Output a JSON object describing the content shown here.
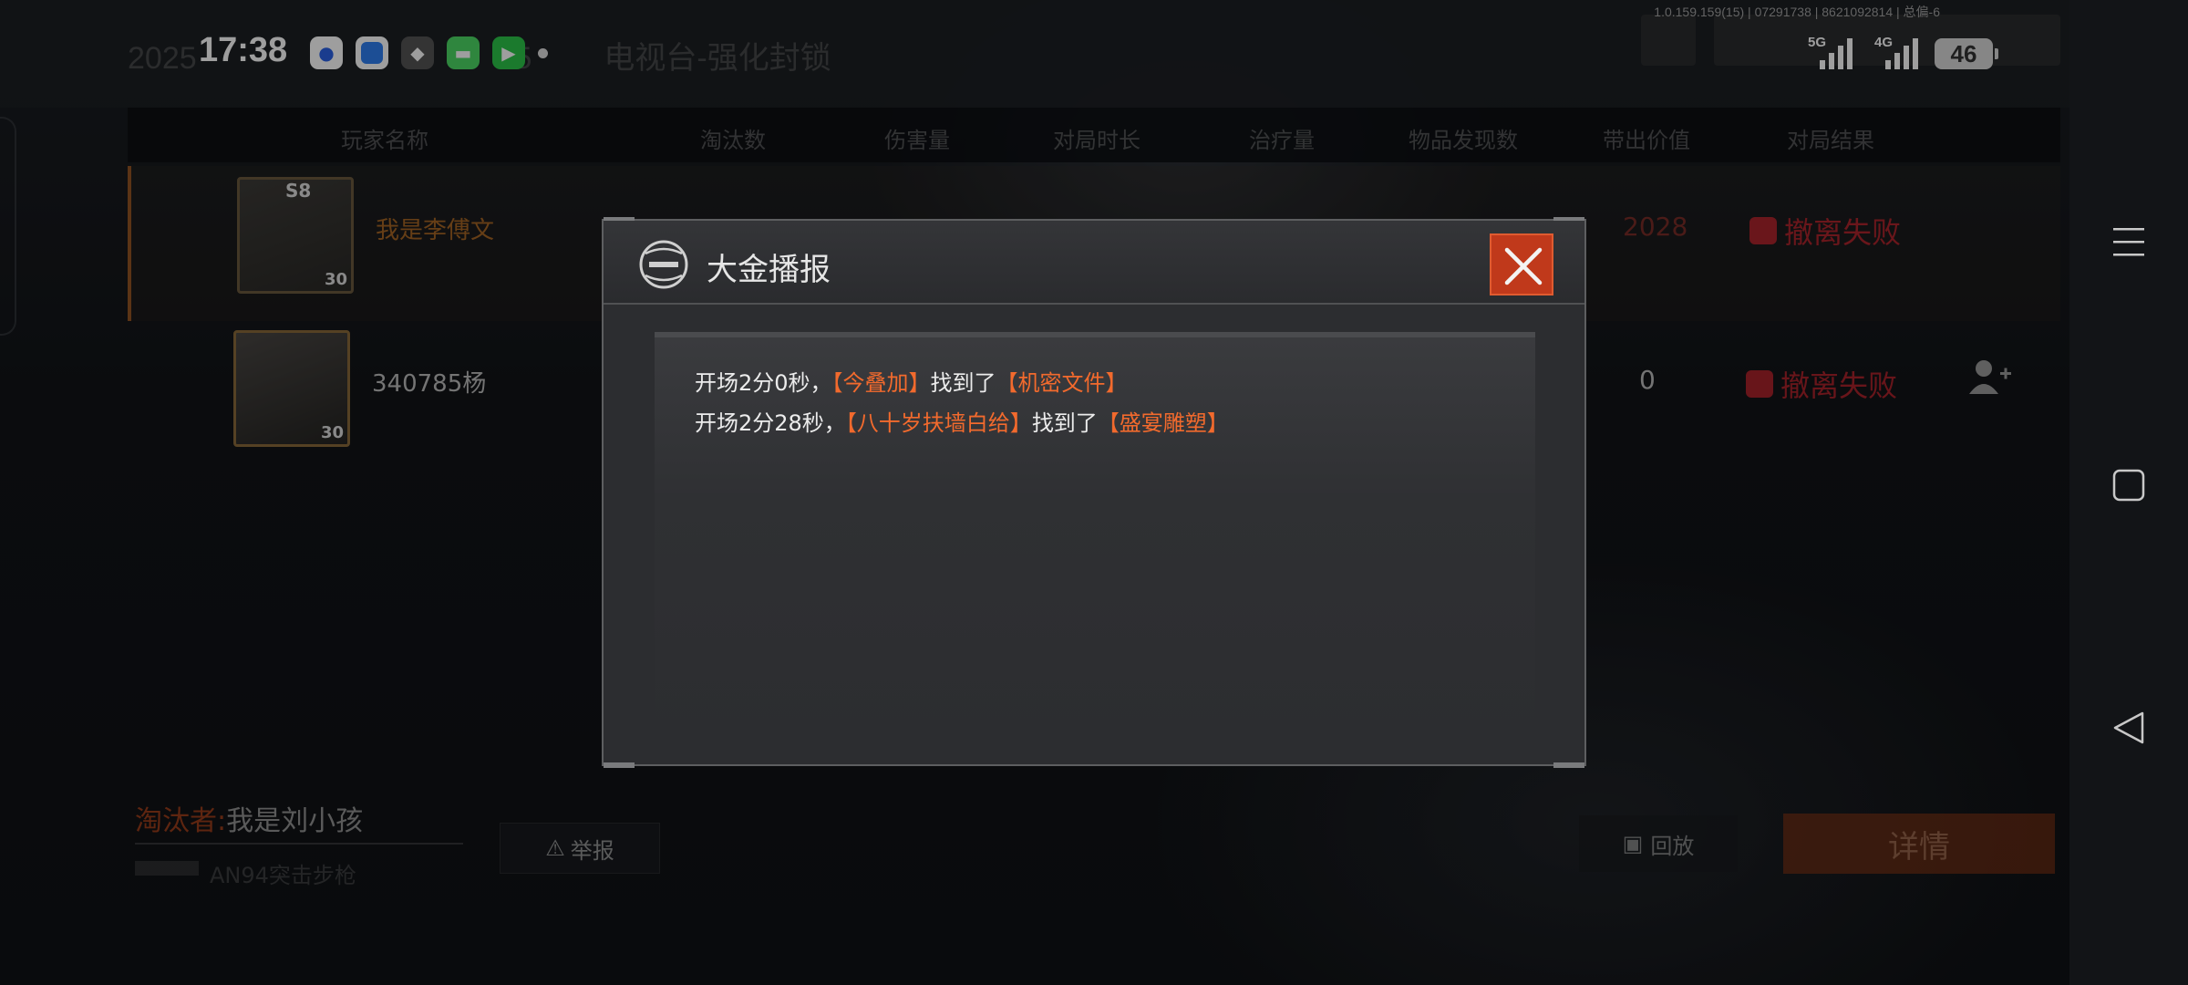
{
  "status_bar": {
    "time": "17:38",
    "apps": [
      "baidu-app-icon",
      "browser-app-icon",
      "game-app-icon",
      "messages-app-icon",
      "facetime-app-icon"
    ],
    "network_1": "5G",
    "network_2": "4G",
    "battery": "46",
    "version_text": "1.0.159.159(15) | 07291738 | 8621092814 | 总偏-6"
  },
  "background_header": {
    "date_fragment": "2025",
    "map_name": "电视台-强化封锁",
    "separator": "5"
  },
  "table": {
    "headers": [
      "玩家名称",
      "淘汰数",
      "伤害量",
      "对局时长",
      "治疗量",
      "物品发现数",
      "带出价值",
      "对局结果"
    ],
    "rows": [
      {
        "name": "我是李傅文",
        "level": "30",
        "tag": "S8",
        "value": "2028",
        "result": "撤离失败",
        "is_self": true
      },
      {
        "name": "340785杨",
        "level": "30",
        "tag": "",
        "value": "0",
        "result": "撤离失败",
        "is_self": false
      }
    ]
  },
  "footer": {
    "killer_label": "淘汰者:",
    "killer_name": "我是刘小孩",
    "weapon": "AN94突击步枪",
    "report_label": "举报",
    "replay_label": "回放",
    "detail_label": "详情"
  },
  "modal": {
    "title": "大金播报",
    "messages": [
      {
        "prefix": "开场2分0秒，",
        "player": "【今叠加】",
        "verb": "找到了",
        "item": "【机密文件】"
      },
      {
        "prefix": "开场2分28秒，",
        "player": "【八十岁扶墙白给】",
        "verb": "找到了",
        "item": "【盛宴雕塑】"
      }
    ]
  },
  "colors": {
    "accent_orange": "#f26a2d",
    "close_red": "#c0391b",
    "fail_red": "#dc2832"
  }
}
